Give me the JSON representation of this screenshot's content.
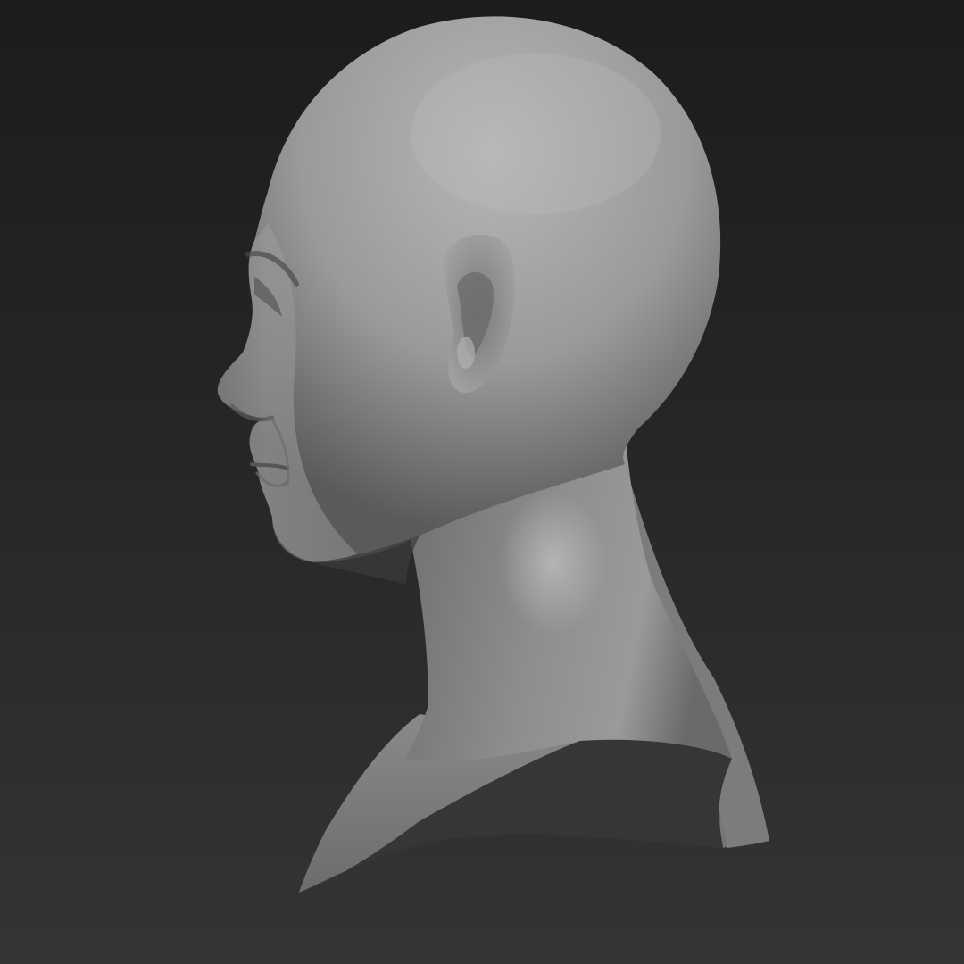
{
  "scene": {
    "subject": "sculpted-bust-side-profile",
    "colors": {
      "background_top": "#1c1c1c",
      "background_bottom": "#343434",
      "clay_light": "#b4b4b4",
      "clay_mid": "#8e8e8e",
      "clay_dark": "#4a4a4a",
      "cut_surface": "#393939"
    }
  }
}
